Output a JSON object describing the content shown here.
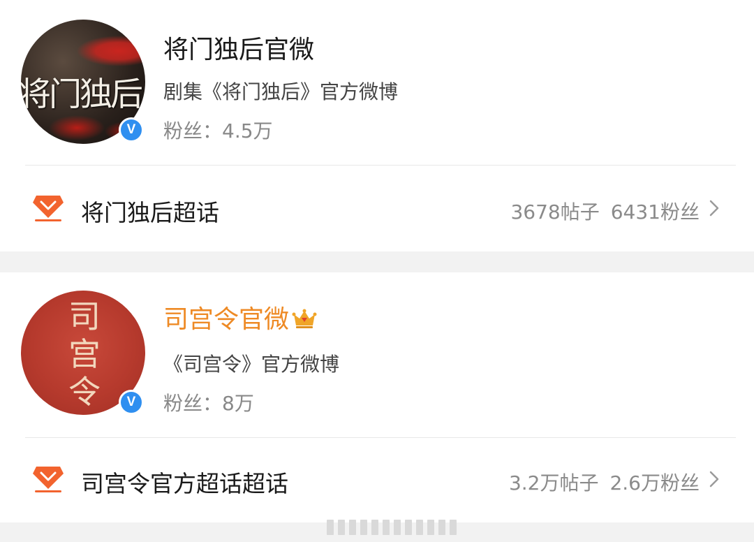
{
  "cards": [
    {
      "account_name": "将门独后官微",
      "avatar_text": "将门独后",
      "description": "剧集《将门独后》官方微博",
      "fans_text": "粉丝：4.5万",
      "verified_badge": "V",
      "topic": {
        "name": "将门独后超话",
        "posts": "3678帖子",
        "fans": "6431粉丝"
      }
    },
    {
      "account_name": "司宫令官微",
      "name_color": "#ee8a25",
      "avatar_text": [
        "司",
        "宫",
        "令"
      ],
      "description": "《司宫令》官方微博",
      "fans_text": "粉丝：8万",
      "verified_badge": "V",
      "topic": {
        "name": "司宫令官方超话超话",
        "posts": "3.2万帖子",
        "fans": "2.6万粉丝"
      }
    }
  ],
  "colors": {
    "verified_blue": "#2f8ff0",
    "topic_icon_orange": "#f2632e",
    "member_gold": "#f0a528"
  },
  "icons": {
    "verified": "verified-v-icon",
    "topic": "super-topic-diamond-icon",
    "member": "member-crown-icon",
    "chevron": "chevron-right-icon"
  }
}
